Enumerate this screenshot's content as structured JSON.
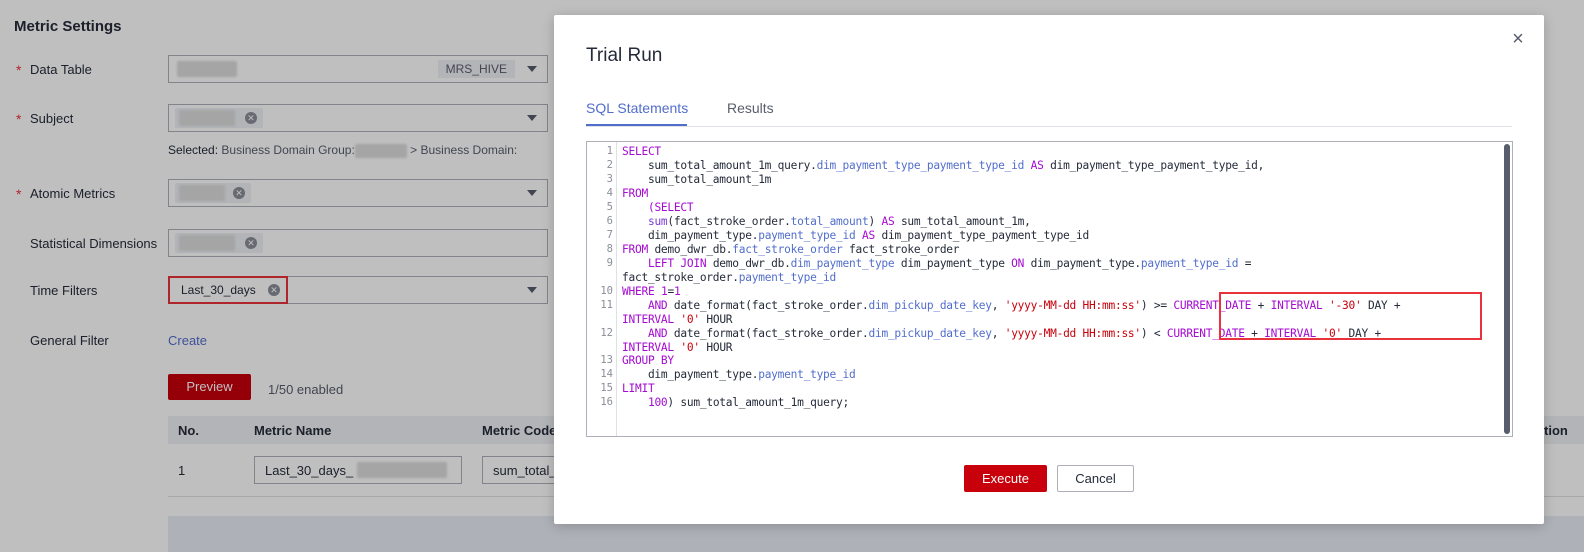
{
  "background": {
    "section_title": "Metric Settings",
    "form": {
      "data_table_label": "Data Table",
      "data_table_tag": "MRS_HIVE",
      "subject_label": "Subject",
      "selected_prefix": "Selected:",
      "selected_group": "Business Domain Group:",
      "selected_arrow": ">",
      "selected_domain": "Business Domain:",
      "atomic_metrics_label": "Atomic Metrics",
      "statistical_dimensions_label": "Statistical Dimensions",
      "time_filters_label": "Time Filters",
      "time_filter_tag": "Last_30_days",
      "general_filter_label": "General Filter",
      "general_filter_link": "Create",
      "required_mark": "*"
    },
    "preview_button": "Preview",
    "enabled_count": "1/50 enabled",
    "table": {
      "headers": [
        "No.",
        "Metric Name",
        "Metric Code",
        "tion"
      ],
      "row": {
        "no": "1",
        "metric_name": "Last_30_days_",
        "metric_code": "sum_total_a"
      }
    }
  },
  "modal": {
    "title": "Trial Run",
    "close_glyph": "×",
    "tabs": [
      {
        "label": "SQL Statements",
        "active": true
      },
      {
        "label": "Results",
        "active": false
      }
    ],
    "execute_label": "Execute",
    "cancel_label": "Cancel",
    "line_numbers": [
      "1",
      "2",
      "3",
      "4",
      "5",
      "6",
      "7",
      "8",
      "9",
      "",
      "10",
      "11",
      "",
      "12",
      "",
      "13",
      "14",
      "15",
      "16"
    ]
  },
  "colors": {
    "accent": "#526ecc",
    "primary_button": "#c7000b",
    "highlight_border": "#e9323b",
    "keyword": "#a50bd1",
    "identifier": "#526ecc"
  }
}
